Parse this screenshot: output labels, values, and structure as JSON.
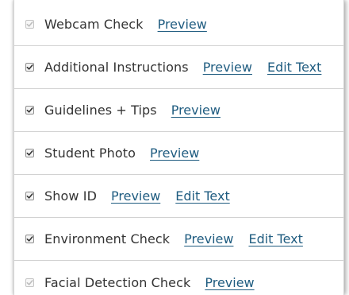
{
  "colors": {
    "text": "#333333",
    "link": "#1f5c80",
    "divider": "#d2d2d2",
    "checkbox_disabled": "#bdbdbd",
    "checkbox_enabled": "#333333"
  },
  "icons": {
    "checkbox": "checkbox-checked-icon"
  },
  "rows": [
    {
      "label": "Webcam Check",
      "checked": true,
      "disabled": true,
      "preview": "Preview",
      "edit": null
    },
    {
      "label": "Additional Instructions",
      "checked": true,
      "disabled": false,
      "preview": "Preview",
      "edit": "Edit Text"
    },
    {
      "label": "Guidelines + Tips",
      "checked": true,
      "disabled": false,
      "preview": "Preview",
      "edit": null
    },
    {
      "label": "Student Photo",
      "checked": true,
      "disabled": false,
      "preview": "Preview",
      "edit": null
    },
    {
      "label": "Show ID",
      "checked": true,
      "disabled": false,
      "preview": "Preview",
      "edit": "Edit Text"
    },
    {
      "label": "Environment Check",
      "checked": true,
      "disabled": false,
      "preview": "Preview",
      "edit": "Edit Text"
    },
    {
      "label": "Facial Detection Check",
      "checked": true,
      "disabled": true,
      "preview": "Preview",
      "edit": null
    }
  ]
}
